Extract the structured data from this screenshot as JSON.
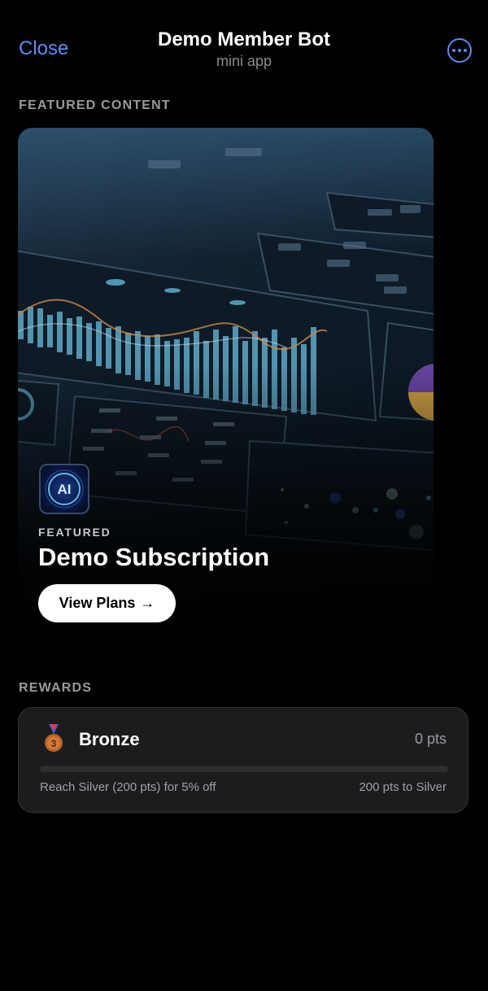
{
  "header": {
    "close_label": "Close",
    "title": "Demo Member Bot",
    "subtitle": "mini app",
    "more_icon": "ellipsis-circle-icon"
  },
  "featured": {
    "section_label": "FEATURED CONTENT",
    "eyebrow": "FEATURED",
    "title": "Demo Subscription",
    "button_label": "View Plans",
    "button_arrow": "→",
    "logo_text": "AI",
    "image_description_icon": "analytics-dashboard-image"
  },
  "rewards": {
    "section_label": "REWARDS",
    "tier_icon": "bronze-medal-icon",
    "tier_name": "Bronze",
    "points": "0 pts",
    "progress_fraction": 0,
    "hint": "Reach Silver (200 pts) for 5% off",
    "remaining": "200 pts to Silver"
  },
  "colors": {
    "background": "#000000",
    "accent": "#5b8def",
    "card": "#1c1c1e",
    "muted_text": "#9a9a9f",
    "bronze": "#b5652c"
  }
}
